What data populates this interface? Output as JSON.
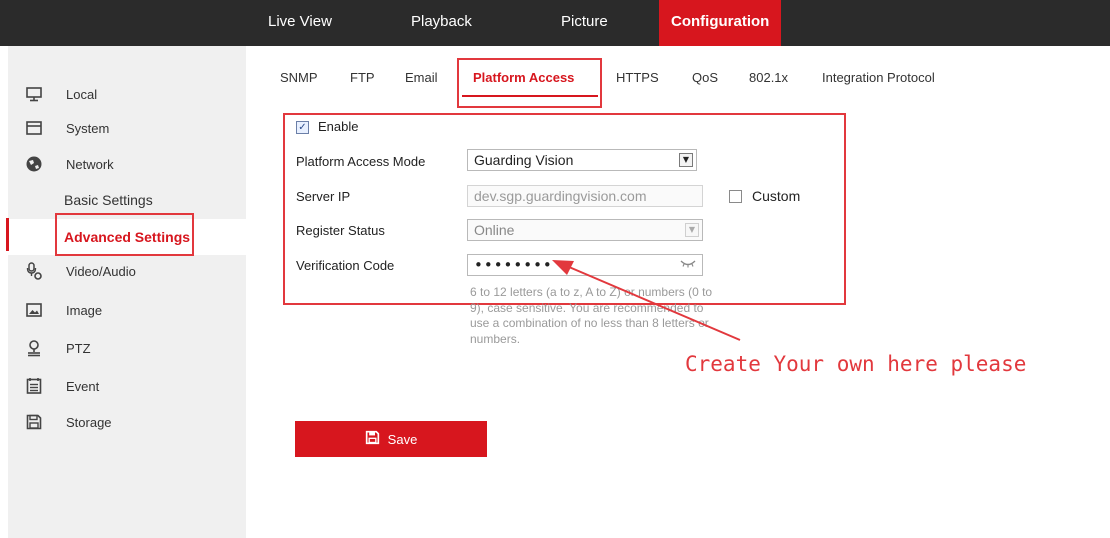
{
  "topnav": {
    "live_view": "Live View",
    "playback": "Playback",
    "picture": "Picture",
    "configuration": "Configuration"
  },
  "sidebar": {
    "local": "Local",
    "system": "System",
    "network": "Network",
    "basic_settings": "Basic Settings",
    "advanced_settings": "Advanced Settings",
    "video_audio": "Video/Audio",
    "image": "Image",
    "ptz": "PTZ",
    "event": "Event",
    "storage": "Storage"
  },
  "subtabs": {
    "snmp": "SNMP",
    "ftp": "FTP",
    "email": "Email",
    "platform_access": "Platform Access",
    "https": "HTTPS",
    "qos": "QoS",
    "dot1x": "802.1x",
    "integration_protocol": "Integration Protocol"
  },
  "form": {
    "enable_label": "Enable",
    "enable_checked": true,
    "mode_label": "Platform Access Mode",
    "mode_value": "Guarding Vision",
    "server_ip_label": "Server IP",
    "server_ip_value": "dev.sgp.guardingvision.com",
    "custom_label": "Custom",
    "custom_checked": false,
    "register_status_label": "Register Status",
    "register_status_value": "Online",
    "verification_label": "Verification Code",
    "verification_value": "••••••••",
    "verification_hint": "6 to 12 letters (a to z, A to Z) or numbers (0 to 9), case sensitive. You are recommended to use a combination of no less than 8 letters or numbers.",
    "save_label": "Save"
  },
  "annotation": {
    "text": "Create Your own here please",
    "color": "#e2383d"
  },
  "colors": {
    "accent": "#d7161e",
    "topbar": "#2b2b2b",
    "sidebar_bg": "#f0f0f0"
  }
}
